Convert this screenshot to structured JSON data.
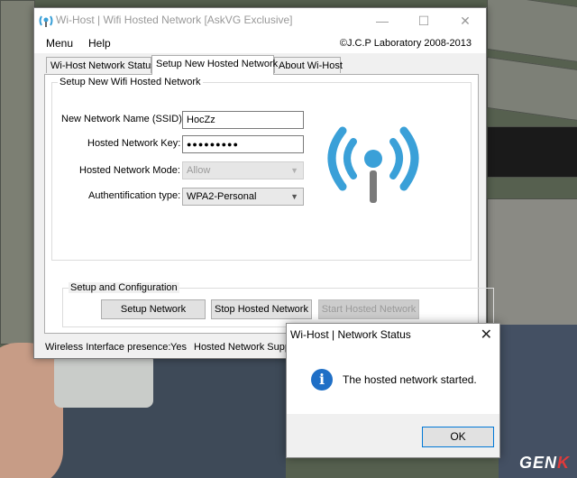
{
  "window": {
    "title": "Wi-Host | Wifi Hosted Network [AskVG Exclusive]",
    "minimize": "—",
    "maximize": "☐",
    "close": "✕"
  },
  "menu": {
    "items": [
      "Menu",
      "Help"
    ],
    "copyright": "©J.C.P Laboratory 2008-2013"
  },
  "tabs": [
    "Wi-Host Network Status",
    "Setup New Hosted Network",
    "About Wi-Host"
  ],
  "active_tab": "Setup New Hosted Network",
  "setup": {
    "group_title": "Setup New Wifi Hosted Network",
    "ssid_label": "New Network Name (SSID):",
    "ssid_value": "HocZz",
    "key_label": "Hosted Network Key:",
    "key_value": "●●●●●●●●●",
    "mode_label": "Hosted Network Mode:",
    "mode_value": "Allow",
    "auth_label": "Authentification type:",
    "auth_value": "WPA2-Personal",
    "wifi_icon": "wifi-broadcast-icon",
    "accent": "#3aa0d8"
  },
  "config": {
    "group_title": "Setup and Configuration",
    "setup_button": "Setup Network",
    "stop_button": "Stop Hosted Network",
    "start_button": "Start Hosted Network"
  },
  "status": {
    "interface_label": "Wireless Interface presence:",
    "interface_value": "Yes",
    "hosted_label": "Hosted Network Suppo"
  },
  "dialog": {
    "title": "Wi-Host | Network Status",
    "close": "✕",
    "icon": "information-icon",
    "message": "The hosted network started.",
    "ok_button": "OK"
  },
  "watermark": {
    "text": "GEN",
    "x": "K"
  }
}
